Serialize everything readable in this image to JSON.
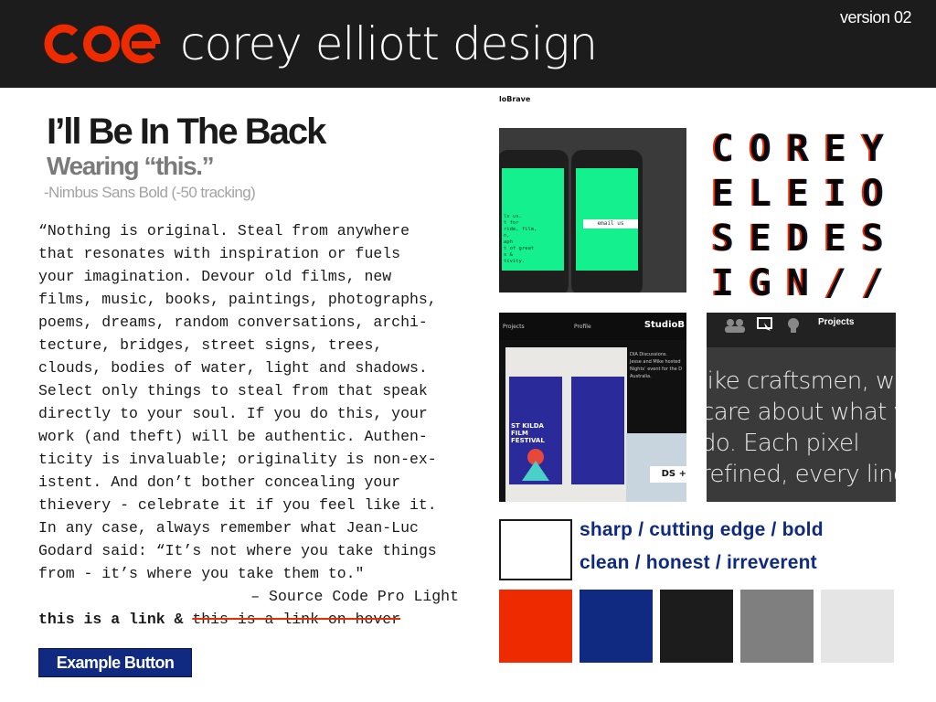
{
  "header": {
    "logo_text": "coe",
    "brand": "corey elliott design",
    "version": "version 02"
  },
  "typography": {
    "heading": "I’ll Be In The Back",
    "subheading": "Wearing “this.”",
    "font_note": "-Nimbus Sans Bold (-50 tracking)"
  },
  "quote": {
    "lines": [
      "“Nothing is original. Steal from anywhere",
      "that resonates with inspiration or fuels",
      "your imagination. Devour old films, new",
      "films, music, books, paintings, photographs,",
      "poems, dreams, random conversations, archi-",
      "tecture, bridges, street signs, trees,",
      "clouds, bodies of water, light and shadows.",
      "Select only things to steal from that speak",
      "directly to your soul. If you do this, your",
      "work (and theft) will be authentic. Authen-",
      "ticity is invaluable; originality is non-ex-",
      "istent. And don’t bother concealing your",
      "thievery - celebrate it if you feel like it.",
      "In any case, always remember what Jean-Luc",
      "Godard said: “It’s not where you take things",
      "from - it’s where you take them to.\""
    ],
    "credit": "– Source Code Pro Light"
  },
  "links": {
    "link": "this is a link",
    "amp": " & ",
    "link_hover": "this is a link on hover"
  },
  "button": {
    "label": "Example Button"
  },
  "thumbnails": {
    "t1_header": "loBrave",
    "t1_input": "email us",
    "t1_body": "ls us.\nt for\nride, film,\nn,\naph\nt of great\ns &\ntivity.",
    "t2_letters": [
      "C",
      "O",
      "R",
      "E",
      "Y",
      "E",
      "L",
      "E",
      "I",
      "O",
      "S",
      "E",
      "D",
      "E",
      "S",
      "I",
      "G",
      "N",
      "/",
      "/"
    ],
    "t3_nav": [
      "Projects",
      "Profile"
    ],
    "t3_brand": "StudioB",
    "t3_info": "DIA Discussions.\nJesse and Mike hosted\nNights’ event for the D\nAustralia.",
    "t3_poster": "ST KILDA\nFILM\nFESTIVAL",
    "t3_cta": "DS +",
    "t4_tab": "Projects",
    "t4_text": [
      "like craftsmen, we",
      "care about what we",
      "do. Each pixel",
      "refined, every line o"
    ]
  },
  "keywords": {
    "line1": "sharp / cutting edge / bold",
    "line2": "clean / honest / irreverent"
  },
  "palette": {
    "swatches": [
      "#ffffff",
      "#ee2a00",
      "#0f2a80",
      "#1c1c1c",
      "#7f7f7f",
      "#e5e5e5"
    ]
  }
}
